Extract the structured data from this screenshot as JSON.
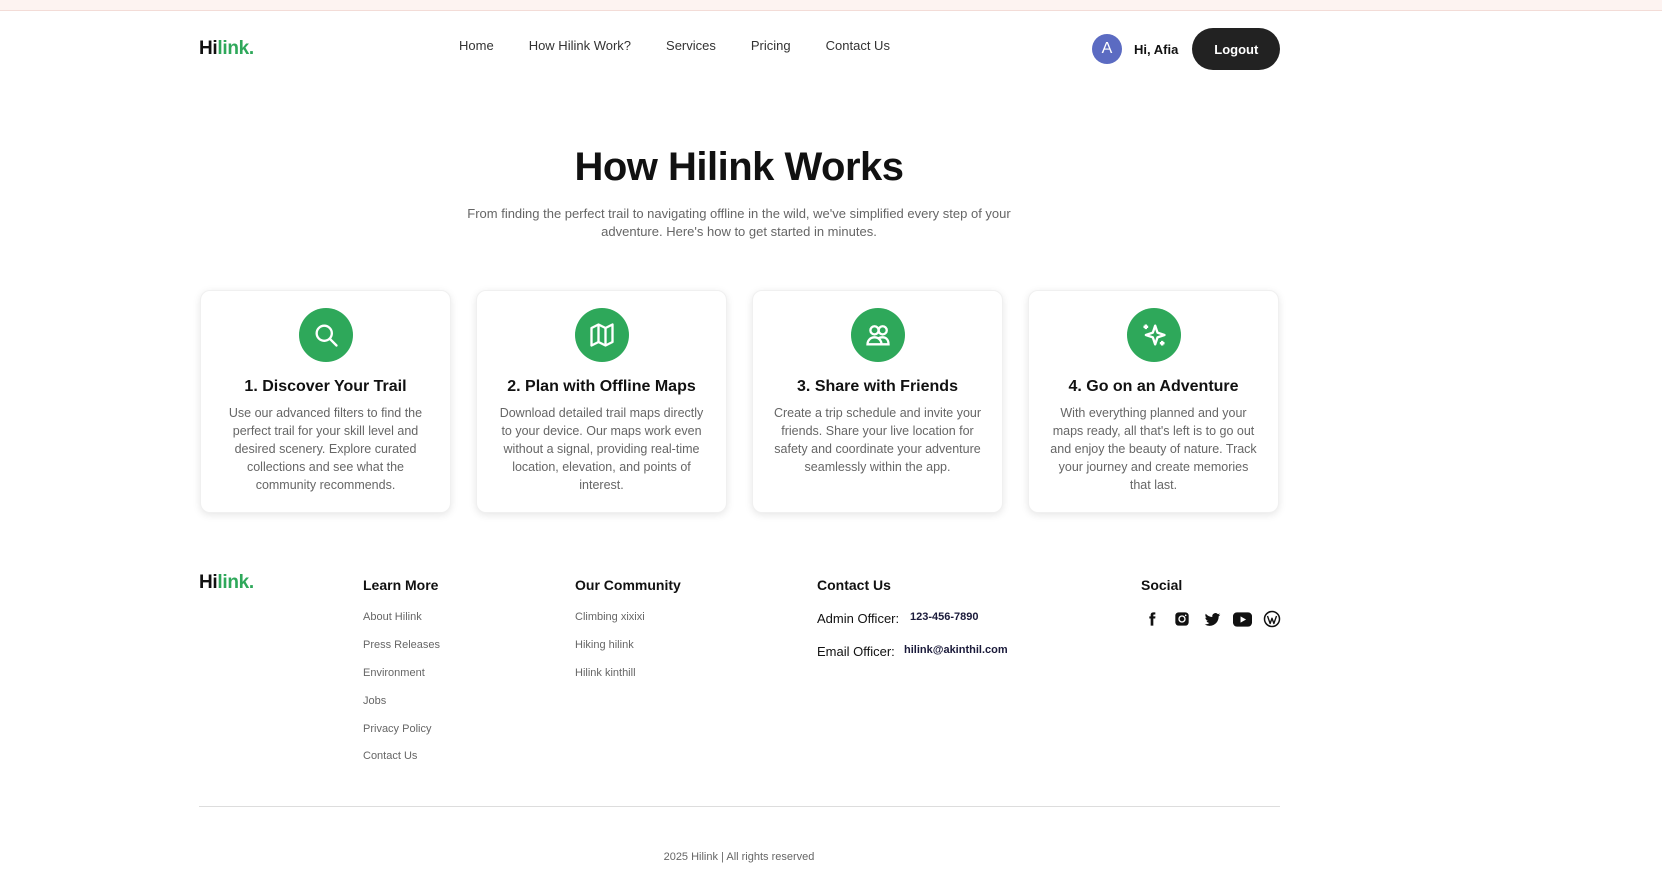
{
  "header": {
    "logo_hi": "Hi",
    "logo_link": "link.",
    "nav": [
      "Home",
      "How Hilink Work?",
      "Services",
      "Pricing",
      "Contact Us"
    ],
    "avatar_initial": "A",
    "greeting": "Hi, Afia",
    "logout_label": "Logout"
  },
  "hero": {
    "title": "How Hilink Works",
    "subtitle": "From finding the perfect trail to navigating offline in the wild, we've simplified every step of your adventure. Here's how to get started in minutes."
  },
  "steps": [
    {
      "icon": "search-icon",
      "title": "1. Discover Your Trail",
      "text": "Use our advanced filters to find the perfect trail for your skill level and desired scenery. Explore curated collections and see what the community recommends."
    },
    {
      "icon": "map-icon",
      "title": "2. Plan with Offline Maps",
      "text": "Download detailed trail maps directly to your device. Our maps work even without a signal, providing real-time location, elevation, and points of interest."
    },
    {
      "icon": "users-icon",
      "title": "3. Share with Friends",
      "text": "Create a trip schedule and invite your friends. Share your live location for safety and coordinate your adventure seamlessly within the app."
    },
    {
      "icon": "sparkles-icon",
      "title": "4. Go on an Adventure",
      "text": "With everything planned and your maps ready, all that's left is to go out and enjoy the beauty of nature. Track your journey and create memories that last."
    }
  ],
  "footer": {
    "logo_hi": "Hi",
    "logo_link": "link.",
    "learn_more": {
      "title": "Learn More",
      "links": [
        "About Hilink",
        "Press Releases",
        "Environment",
        "Jobs",
        "Privacy Policy",
        "Contact Us"
      ]
    },
    "community": {
      "title": "Our Community",
      "links": [
        "Climbing xixixi",
        "Hiking hilink",
        "Hilink kinthill"
      ]
    },
    "contact": {
      "title": "Contact Us",
      "admin_label": "Admin Officer:",
      "admin_value": "123-456-7890",
      "email_label": "Email Officer:",
      "email_value": "hilink@akinthil.com"
    },
    "social": {
      "title": "Social",
      "icons": [
        "facebook-icon",
        "instagram-icon",
        "twitter-icon",
        "youtube-icon",
        "wordpress-icon"
      ]
    },
    "copyright": "2025 Hilink | All rights reserved"
  },
  "colors": {
    "brand_green": "#2ea85a",
    "dark_button": "#222222",
    "avatar": "#5b6bc2"
  }
}
